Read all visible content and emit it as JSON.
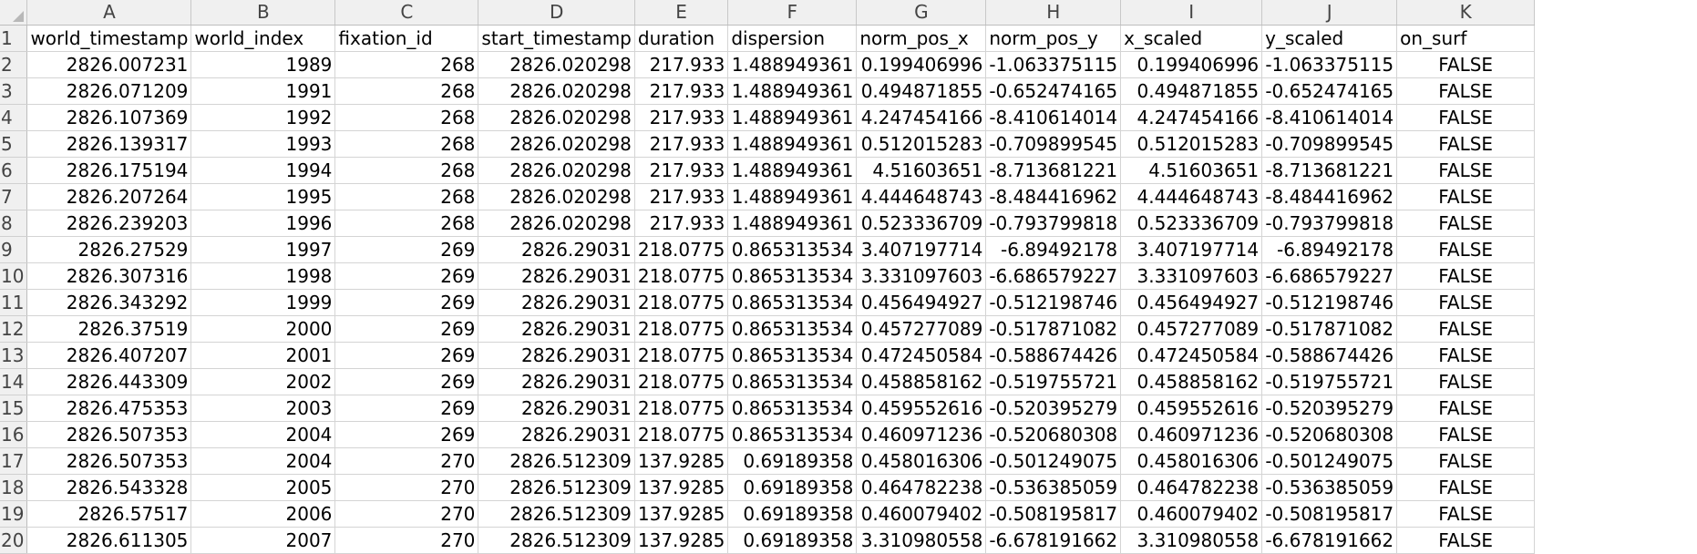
{
  "sheet": {
    "columns": [
      "A",
      "B",
      "C",
      "D",
      "E",
      "F",
      "G",
      "H",
      "I",
      "J",
      "K"
    ],
    "header_row": {
      "number": "1",
      "cells": [
        "world_timestamp",
        "world_index",
        "fixation_id",
        "start_timestamp",
        "duration",
        "dispersion",
        "norm_pos_x",
        "norm_pos_y",
        "x_scaled",
        "y_scaled",
        "on_surf"
      ]
    },
    "rows": [
      {
        "n": "2",
        "cells": [
          "2826.007231",
          "1989",
          "268",
          "2826.020298",
          "217.933",
          "1.488949361",
          "0.199406996",
          "-1.063375115",
          "0.199406996",
          "-1.063375115",
          "FALSE"
        ]
      },
      {
        "n": "3",
        "cells": [
          "2826.071209",
          "1991",
          "268",
          "2826.020298",
          "217.933",
          "1.488949361",
          "0.494871855",
          "-0.652474165",
          "0.494871855",
          "-0.652474165",
          "FALSE"
        ]
      },
      {
        "n": "4",
        "cells": [
          "2826.107369",
          "1992",
          "268",
          "2826.020298",
          "217.933",
          "1.488949361",
          "4.247454166",
          "-8.410614014",
          "4.247454166",
          "-8.410614014",
          "FALSE"
        ]
      },
      {
        "n": "5",
        "cells": [
          "2826.139317",
          "1993",
          "268",
          "2826.020298",
          "217.933",
          "1.488949361",
          "0.512015283",
          "-0.709899545",
          "0.512015283",
          "-0.709899545",
          "FALSE"
        ]
      },
      {
        "n": "6",
        "cells": [
          "2826.175194",
          "1994",
          "268",
          "2826.020298",
          "217.933",
          "1.488949361",
          "4.51603651",
          "-8.713681221",
          "4.51603651",
          "-8.713681221",
          "FALSE"
        ]
      },
      {
        "n": "7",
        "cells": [
          "2826.207264",
          "1995",
          "268",
          "2826.020298",
          "217.933",
          "1.488949361",
          "4.444648743",
          "-8.484416962",
          "4.444648743",
          "-8.484416962",
          "FALSE"
        ]
      },
      {
        "n": "8",
        "cells": [
          "2826.239203",
          "1996",
          "268",
          "2826.020298",
          "217.933",
          "1.488949361",
          "0.523336709",
          "-0.793799818",
          "0.523336709",
          "-0.793799818",
          "FALSE"
        ]
      },
      {
        "n": "9",
        "cells": [
          "2826.27529",
          "1997",
          "269",
          "2826.29031",
          "218.0775",
          "0.865313534",
          "3.407197714",
          "-6.89492178",
          "3.407197714",
          "-6.89492178",
          "FALSE"
        ]
      },
      {
        "n": "10",
        "cells": [
          "2826.307316",
          "1998",
          "269",
          "2826.29031",
          "218.0775",
          "0.865313534",
          "3.331097603",
          "-6.686579227",
          "3.331097603",
          "-6.686579227",
          "FALSE"
        ]
      },
      {
        "n": "11",
        "cells": [
          "2826.343292",
          "1999",
          "269",
          "2826.29031",
          "218.0775",
          "0.865313534",
          "0.456494927",
          "-0.512198746",
          "0.456494927",
          "-0.512198746",
          "FALSE"
        ]
      },
      {
        "n": "12",
        "cells": [
          "2826.37519",
          "2000",
          "269",
          "2826.29031",
          "218.0775",
          "0.865313534",
          "0.457277089",
          "-0.517871082",
          "0.457277089",
          "-0.517871082",
          "FALSE"
        ]
      },
      {
        "n": "13",
        "cells": [
          "2826.407207",
          "2001",
          "269",
          "2826.29031",
          "218.0775",
          "0.865313534",
          "0.472450584",
          "-0.588674426",
          "0.472450584",
          "-0.588674426",
          "FALSE"
        ]
      },
      {
        "n": "14",
        "cells": [
          "2826.443309",
          "2002",
          "269",
          "2826.29031",
          "218.0775",
          "0.865313534",
          "0.458858162",
          "-0.519755721",
          "0.458858162",
          "-0.519755721",
          "FALSE"
        ]
      },
      {
        "n": "15",
        "cells": [
          "2826.475353",
          "2003",
          "269",
          "2826.29031",
          "218.0775",
          "0.865313534",
          "0.459552616",
          "-0.520395279",
          "0.459552616",
          "-0.520395279",
          "FALSE"
        ]
      },
      {
        "n": "16",
        "cells": [
          "2826.507353",
          "2004",
          "269",
          "2826.29031",
          "218.0775",
          "0.865313534",
          "0.460971236",
          "-0.520680308",
          "0.460971236",
          "-0.520680308",
          "FALSE"
        ]
      },
      {
        "n": "17",
        "cells": [
          "2826.507353",
          "2004",
          "270",
          "2826.512309",
          "137.9285",
          "0.69189358",
          "0.458016306",
          "-0.501249075",
          "0.458016306",
          "-0.501249075",
          "FALSE"
        ]
      },
      {
        "n": "18",
        "cells": [
          "2826.543328",
          "2005",
          "270",
          "2826.512309",
          "137.9285",
          "0.69189358",
          "0.464782238",
          "-0.536385059",
          "0.464782238",
          "-0.536385059",
          "FALSE"
        ]
      },
      {
        "n": "19",
        "cells": [
          "2826.57517",
          "2006",
          "270",
          "2826.512309",
          "137.9285",
          "0.69189358",
          "0.460079402",
          "-0.508195817",
          "0.460079402",
          "-0.508195817",
          "FALSE"
        ]
      },
      {
        "n": "20",
        "cells": [
          "2826.611305",
          "2007",
          "270",
          "2826.512309",
          "137.9285",
          "0.69189358",
          "3.310980558",
          "-6.678191662",
          "3.310980558",
          "-6.678191662",
          "FALSE"
        ]
      }
    ]
  }
}
